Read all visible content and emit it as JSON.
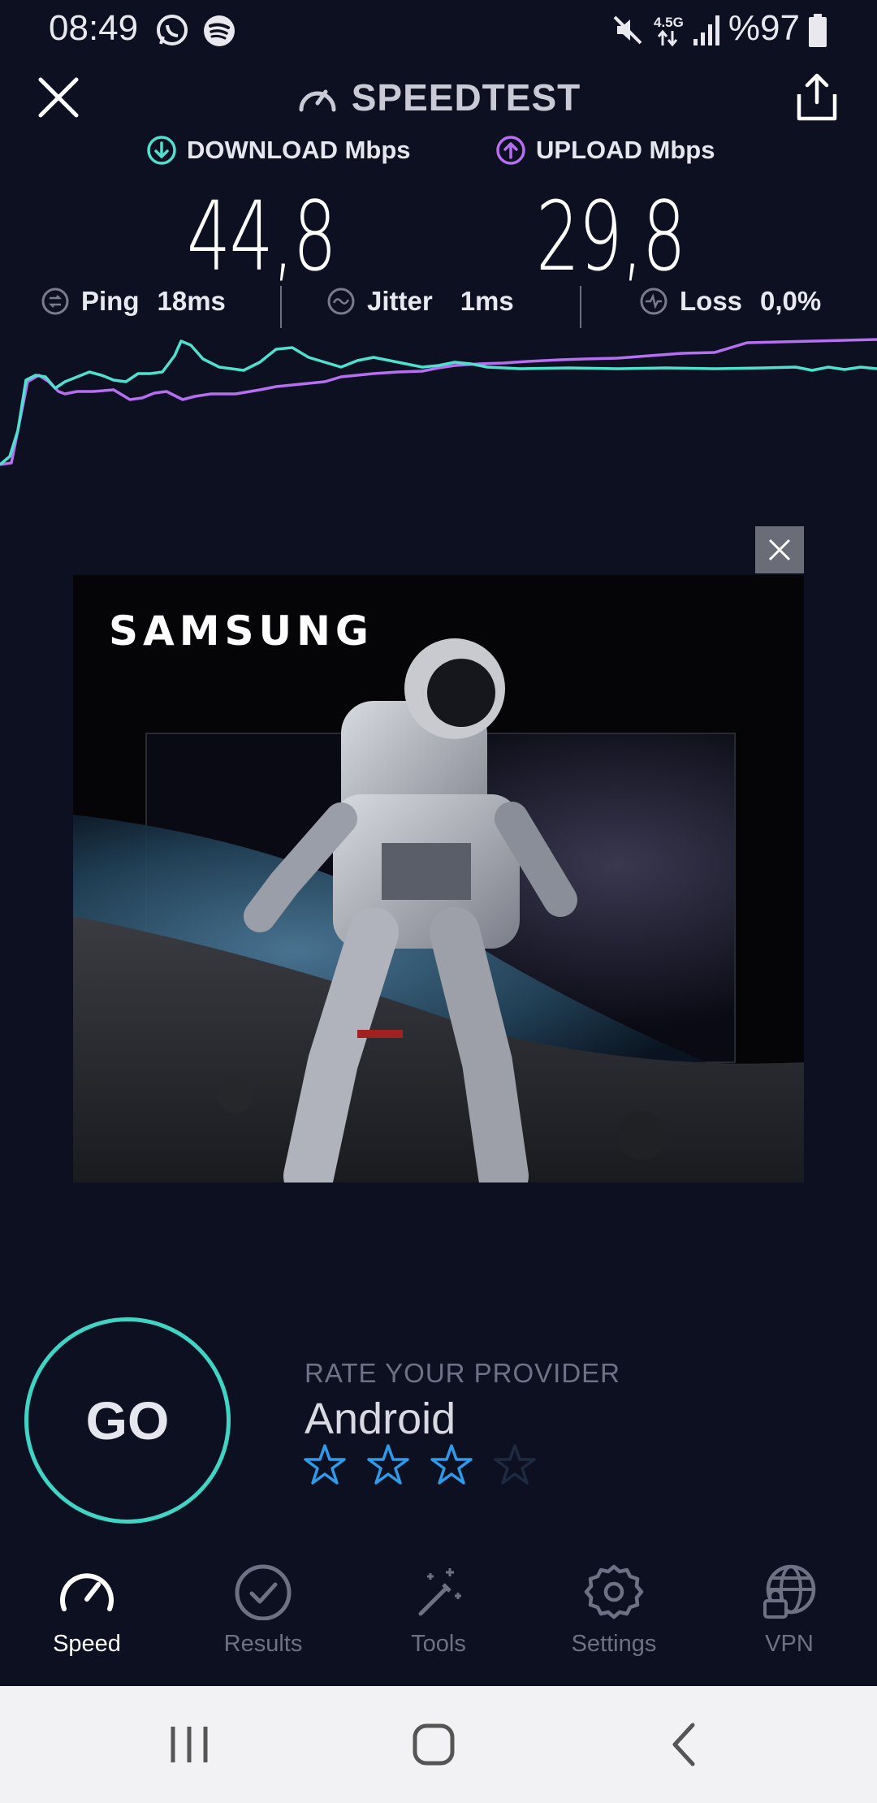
{
  "status_bar": {
    "time": "08:49",
    "network": "4.5G",
    "battery": "%97",
    "icons": [
      "whatsapp-icon",
      "spotify-icon",
      "mute-icon",
      "network-arrows-icon",
      "signal-icon",
      "battery-icon"
    ]
  },
  "header": {
    "title": "SPEEDTEST"
  },
  "metrics": {
    "download_label": "DOWNLOAD Mbps",
    "download_value": "44,8",
    "upload_label": "UPLOAD Mbps",
    "upload_value": "29,8"
  },
  "stats": {
    "ping_label": "Ping",
    "ping_value": "18ms",
    "jitter_label": "Jitter",
    "jitter_value": "1ms",
    "loss_label": "Loss",
    "loss_value": "0,0%"
  },
  "colors": {
    "download": "#4fe0cf",
    "upload": "#b66ff0",
    "go_ring": "#3fd4c4",
    "star": "#2f9ae8",
    "background": "#0d1021"
  },
  "ad": {
    "brand": "SAMSUNG"
  },
  "go_button": {
    "label": "GO"
  },
  "rating": {
    "label": "RATE YOUR PROVIDER",
    "provider": "Android",
    "stars_filled": 3,
    "stars_total": 4
  },
  "nav": {
    "items": [
      {
        "label": "Speed",
        "icon": "speedometer-icon",
        "active": true
      },
      {
        "label": "Results",
        "icon": "checkmark-circle-icon",
        "active": false
      },
      {
        "label": "Tools",
        "icon": "magic-wand-icon",
        "active": false
      },
      {
        "label": "Settings",
        "icon": "gear-icon",
        "active": false
      },
      {
        "label": "VPN",
        "icon": "globe-lock-icon",
        "active": false
      }
    ]
  }
}
